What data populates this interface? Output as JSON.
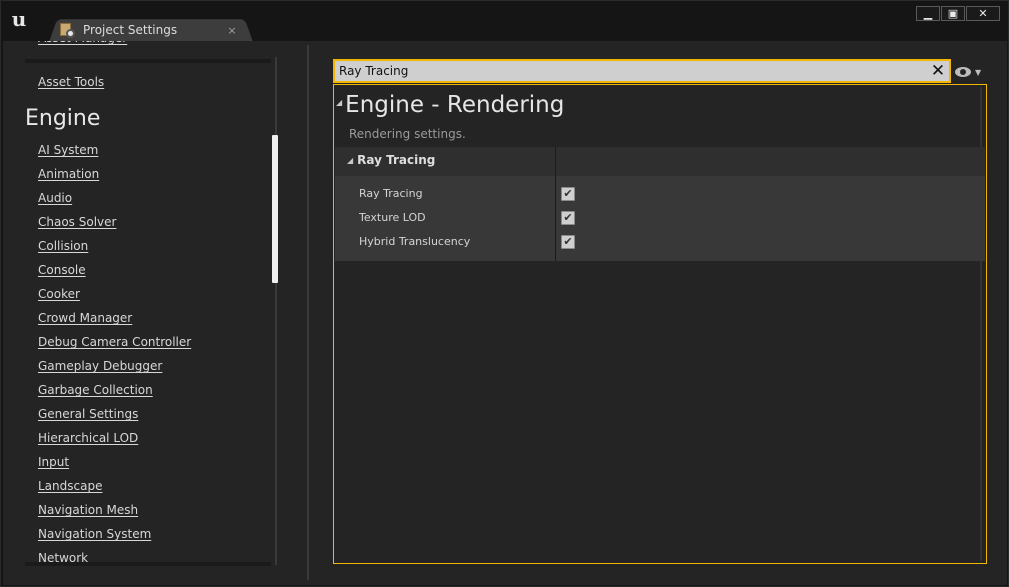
{
  "window": {
    "tab_title": "Project Settings",
    "tab_close": "×",
    "controls": {
      "minimize": "▁",
      "maximize": "▣",
      "close": "✕"
    }
  },
  "sidebar": {
    "top_links": [
      "Asset Tools"
    ],
    "heading": "Engine",
    "items": [
      "AI System",
      "Animation",
      "Audio",
      "Chaos Solver",
      "Collision",
      "Console",
      "Cooker",
      "Crowd Manager",
      "Debug Camera Controller",
      "Gameplay Debugger",
      "Garbage Collection",
      "General Settings",
      "Hierarchical LOD",
      "Input",
      "Landscape",
      "Navigation Mesh",
      "Navigation System",
      "Network"
    ]
  },
  "search": {
    "value": "Ray Tracing",
    "clear_glyph": "✕"
  },
  "details": {
    "section_title": "Engine - Rendering",
    "section_description": "Rendering settings.",
    "category": "Ray Tracing",
    "properties": [
      {
        "label": "Ray Tracing",
        "checked": true
      },
      {
        "label": "Texture LOD",
        "checked": true
      },
      {
        "label": "Hybrid Translucency",
        "checked": true
      }
    ]
  },
  "icons": {
    "logo": "unreal-logo",
    "tab": "project-settings-icon",
    "eye": "eye-icon",
    "expand": "triangle-down-icon"
  },
  "colors": {
    "accent": "#f2b705",
    "panel": "#242424",
    "frame": "#151515"
  }
}
